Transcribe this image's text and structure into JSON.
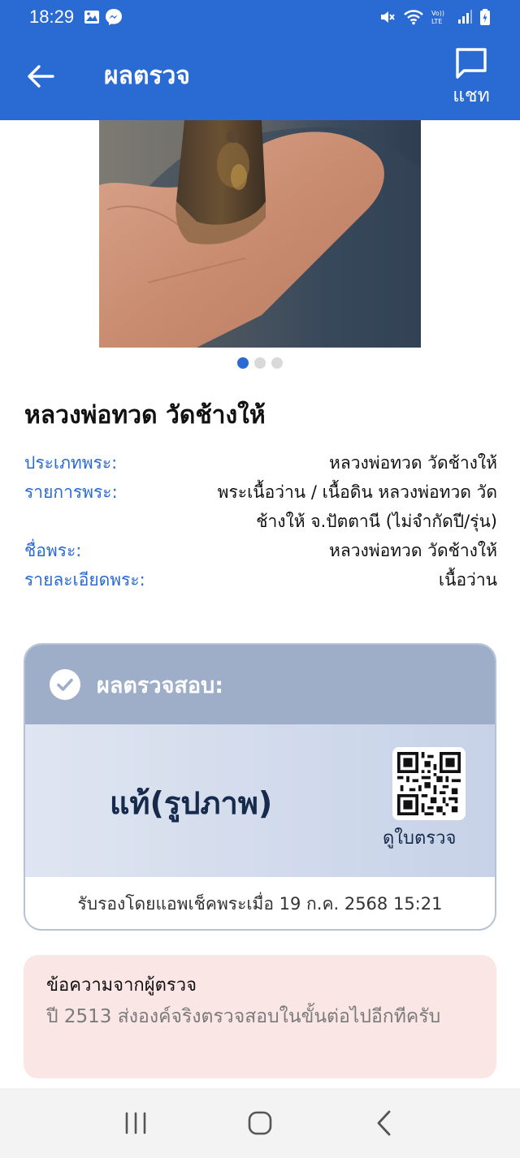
{
  "status_bar": {
    "time": "18:29",
    "icons": [
      "gallery-icon",
      "messenger-icon",
      "mute-icon",
      "wifi-icon",
      "volte-icon",
      "signal-icon",
      "battery-icon"
    ]
  },
  "app_bar": {
    "title": "ผลตรวจ",
    "chat_label": "แชท"
  },
  "gallery": {
    "page_count": 3,
    "active_index": 0
  },
  "amulet": {
    "title": "หลวงพ่อทวด วัดช้างให้",
    "details": [
      {
        "label": "ประเภทพระ:",
        "value": "หลวงพ่อทวด วัดช้างให้"
      },
      {
        "label": "รายการพระ:",
        "value": "พระเนื้อว่าน / เนื้อดิน หลวงพ่อทวด วัดช้างให้ จ.ปัตตานี (ไม่จำกัดปี/รุ่น)"
      },
      {
        "label": "ชื่อพระ:",
        "value": "หลวงพ่อทวด วัดช้างให้"
      },
      {
        "label": "รายละเอียดพระ:",
        "value": "เนื้อว่าน"
      }
    ]
  },
  "result": {
    "header": "ผลตรวจสอบ:",
    "verdict": "แท้(รูปภาพ)",
    "certificate_label": "ดูใบตรวจ",
    "certified_text": "รับรองโดยแอพเช็คพระเมื่อ 19 ก.ค. 2568 15:21"
  },
  "message": {
    "title": "ข้อความจากผู้ตรวจ",
    "body": "ปี 2513 ส่งองค์จริงตรวจสอบในขั้นต่อไปอีกทีครับ"
  },
  "colors": {
    "primary": "#2a6ad3",
    "label_blue": "#2a6ad3",
    "result_header": "#9eaec8",
    "message_bg": "#fbe6e6"
  }
}
